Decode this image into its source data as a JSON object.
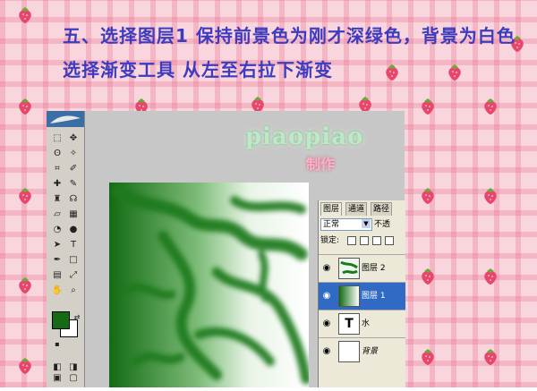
{
  "caption": {
    "line1": "五、选择图层1 保持前景色为刚才深绿色，背景为白色",
    "line2": "选择渐变工具 从左至右拉下渐变"
  },
  "watermark": {
    "name": "piaopiao",
    "tag": "制作"
  },
  "toolbox": {
    "foreground_color": "#136b13",
    "background_color": "#ffffff",
    "tools": [
      {
        "name": "marquee",
        "glyph": "⬚"
      },
      {
        "name": "move",
        "glyph": "✥"
      },
      {
        "name": "lasso",
        "glyph": "ʘ"
      },
      {
        "name": "magic-wand",
        "glyph": "✧"
      },
      {
        "name": "crop",
        "glyph": "⌗"
      },
      {
        "name": "slice",
        "glyph": "✐"
      },
      {
        "name": "healing",
        "glyph": "✚"
      },
      {
        "name": "brush",
        "glyph": "✎"
      },
      {
        "name": "stamp",
        "glyph": "♜"
      },
      {
        "name": "history-brush",
        "glyph": "☊"
      },
      {
        "name": "eraser",
        "glyph": "▱"
      },
      {
        "name": "gradient",
        "glyph": "▦"
      },
      {
        "name": "blur",
        "glyph": "◔"
      },
      {
        "name": "dodge",
        "glyph": "●"
      },
      {
        "name": "path-select",
        "glyph": "➤"
      },
      {
        "name": "type",
        "glyph": "T"
      },
      {
        "name": "pen",
        "glyph": "✒"
      },
      {
        "name": "shape",
        "glyph": "□"
      },
      {
        "name": "notes",
        "glyph": "▤"
      },
      {
        "name": "eyedropper",
        "glyph": "⤢"
      },
      {
        "name": "hand",
        "glyph": "✋"
      },
      {
        "name": "zoom",
        "glyph": "⌕"
      }
    ]
  },
  "layers_panel": {
    "tabs": [
      "图层",
      "通道",
      "路径"
    ],
    "blend_mode": "正常",
    "opacity_label": "不透",
    "lock_label": "锁定:",
    "layers": [
      {
        "name": "图层 2",
        "type": "cloud",
        "selected": false
      },
      {
        "name": "图层 1",
        "type": "gradient",
        "selected": true
      },
      {
        "name": "水",
        "type": "text",
        "selected": false
      },
      {
        "name": "背景",
        "type": "background",
        "selected": false
      }
    ]
  },
  "colors": {
    "caption": "#3d3bbf",
    "canvas_green": "#136b13",
    "selection": "#316ac5"
  }
}
